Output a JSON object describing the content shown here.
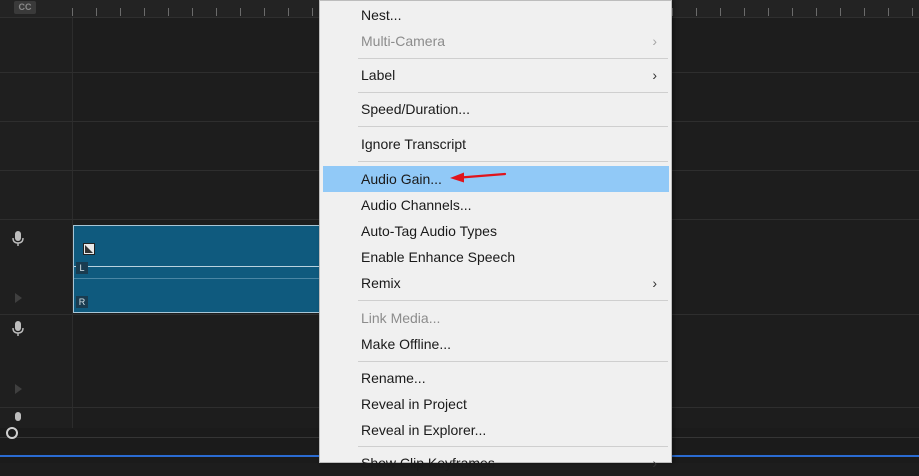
{
  "timeline": {
    "cc_label": "CC",
    "clip": {
      "left_channel_label": "L",
      "right_channel_label": "R"
    }
  },
  "context_menu": {
    "items": [
      {
        "label": "Nest...",
        "enabled": true
      },
      {
        "label": "Multi-Camera",
        "enabled": false,
        "submenu_glyph": "›"
      },
      {
        "label": "Label",
        "enabled": true,
        "submenu_glyph": "›"
      },
      {
        "label": "Speed/Duration...",
        "enabled": true
      },
      {
        "label": "Ignore Transcript",
        "enabled": true
      },
      {
        "label": "Audio Gain...",
        "enabled": true,
        "highlighted": true
      },
      {
        "label": "Audio Channels...",
        "enabled": true
      },
      {
        "label": "Auto-Tag Audio Types",
        "enabled": true
      },
      {
        "label": "Enable Enhance Speech",
        "enabled": true
      },
      {
        "label": "Remix",
        "enabled": true,
        "submenu_glyph": "›"
      },
      {
        "label": "Link Media...",
        "enabled": false
      },
      {
        "label": "Make Offline...",
        "enabled": true
      },
      {
        "label": "Rename...",
        "enabled": true
      },
      {
        "label": "Reveal in Project",
        "enabled": true
      },
      {
        "label": "Reveal in Explorer...",
        "enabled": true
      },
      {
        "label": "Show Clip Keyframes",
        "enabled": true,
        "submenu_glyph": "›"
      }
    ]
  },
  "colors": {
    "highlight": "#91c9f7",
    "clip_fill": "#0f5a7e",
    "annotation_arrow": "#e0141c",
    "timeline_bg": "#1d1d1d"
  },
  "icons": {
    "track_mic": "microphone-icon",
    "clip_fx": "fx-badge-icon",
    "annotation": "red-arrow-icon"
  }
}
